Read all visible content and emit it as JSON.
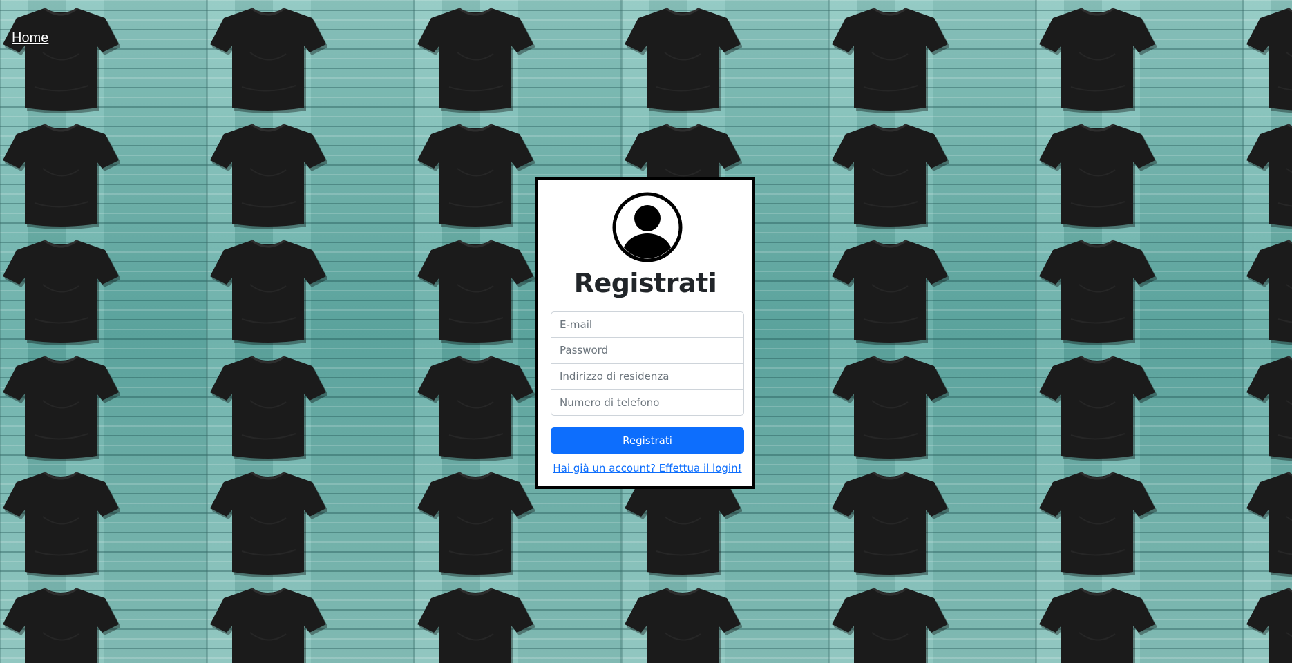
{
  "nav": {
    "home_label": "Home"
  },
  "background": {
    "pattern": "black t-shirts on teal wood planks",
    "colors": {
      "wood": "#6fb1ab",
      "shirt": "#1b1b1b"
    }
  },
  "register_card": {
    "avatar_icon": "user-circle-icon",
    "title": "Registrati",
    "fields": {
      "email_placeholder": "E-mail",
      "password_placeholder": "Password",
      "address_placeholder": "Indirizzo di residenza",
      "phone_placeholder": "Numero di telefono"
    },
    "submit_label": "Registrati",
    "login_link_label": "Hai già un account? Effettua il login!",
    "colors": {
      "primary": "#0d6efd",
      "border": "#000000"
    }
  }
}
